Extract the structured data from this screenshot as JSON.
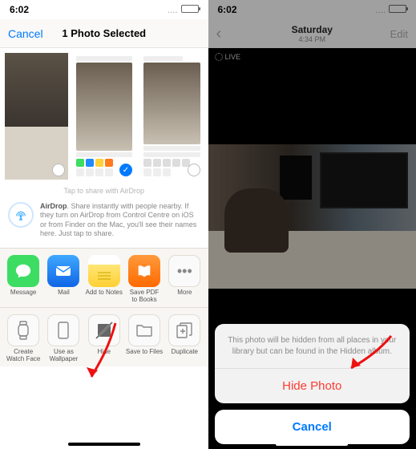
{
  "left": {
    "status": {
      "time": "6:02"
    },
    "nav": {
      "cancel": "Cancel",
      "title": "1 Photo Selected"
    },
    "tap_to_share": "Tap to share with AirDrop",
    "airdrop": {
      "title": "AirDrop",
      "body": ". Share instantly with people nearby. If they turn on AirDrop from Control Centre on iOS or from Finder on the Mac, you'll see their names here. Just tap to share."
    },
    "apps": [
      {
        "label": "Message",
        "color": "#3ddc63"
      },
      {
        "label": "Mail",
        "color": "#1f8bff"
      },
      {
        "label": "Add to Notes",
        "color": "#ffd23a"
      },
      {
        "label": "Save PDF\nto Books",
        "color": "#ff7b1c"
      },
      {
        "label": "More",
        "color": "#ffffff"
      }
    ],
    "system": [
      {
        "label": "Create\nWatch Face"
      },
      {
        "label": "Use as\nWallpaper"
      },
      {
        "label": "Hide"
      },
      {
        "label": "Save to Files"
      },
      {
        "label": "Duplicate"
      }
    ]
  },
  "right": {
    "status": {
      "time": "6:02"
    },
    "nav": {
      "title": "Saturday",
      "subtitle": "4:34 PM",
      "edit": "Edit"
    },
    "live": "LIVE",
    "sheet": {
      "message": "This photo will be hidden from all places in your library but can be found in the Hidden album.",
      "destructive": "Hide Photo",
      "cancel": "Cancel"
    }
  }
}
